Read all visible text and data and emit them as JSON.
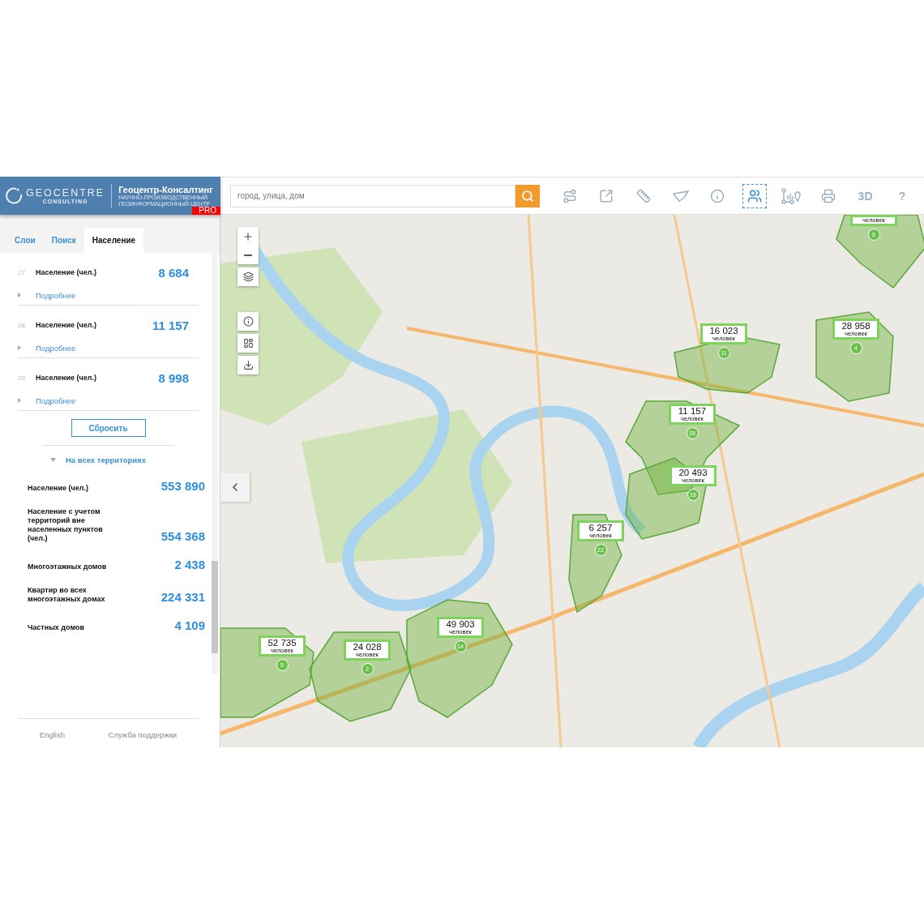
{
  "header": {
    "logo_word": "GEOCENTRE",
    "logo_sub": "CONSULTING",
    "title": "Геоцентр-Консалтинг",
    "subtitle_lines": [
      "НАУЧНО-ПРОИЗВОДСТВЕННЫЙ",
      "ГЕОИНФОРМАЦИОННЫЙ ЦЕНТР"
    ],
    "badge": "PRO"
  },
  "search": {
    "placeholder": "город, улица, дом"
  },
  "toolbar": [
    {
      "kind": "route",
      "selected": false
    },
    {
      "kind": "external",
      "selected": false
    },
    {
      "kind": "ruler",
      "selected": false
    },
    {
      "kind": "polygon",
      "selected": false
    },
    {
      "kind": "info",
      "selected": false
    },
    {
      "kind": "population",
      "selected": true
    },
    {
      "kind": "analytics",
      "selected": false
    },
    {
      "kind": "print",
      "selected": false
    },
    {
      "kind": "text",
      "label": "3D",
      "selected": false
    },
    {
      "kind": "text",
      "label": "?",
      "selected": false
    }
  ],
  "tabs": [
    {
      "label": "Слои",
      "selected": false
    },
    {
      "label": "Поиск",
      "selected": false
    },
    {
      "label": "Население",
      "selected": true
    }
  ],
  "results": [
    {
      "index": "27",
      "label": "Население (чел.)",
      "value": "8 684",
      "link": "Подробнее"
    },
    {
      "index": "28",
      "label": "Население (чел.)",
      "value": "11 157",
      "link": "Подробнее"
    },
    {
      "index": "29",
      "label": "Население (чел.)",
      "value": "8 998",
      "link": "Подробнее"
    }
  ],
  "reset_button": "Сбросить",
  "totals": {
    "title": "На всех территориях",
    "expanded": true,
    "rows": [
      {
        "label": "Население (чел.)",
        "value": "553 890"
      },
      {
        "label": "Население с учетом территорий вне населенных пунктов (чел.)",
        "value": "554 368"
      },
      {
        "label": "Многоэтажных домов",
        "value": "2 438"
      },
      {
        "label": "Квартир во всех многоэтажных домах",
        "value": "224 331"
      },
      {
        "label": "Частных домов",
        "value": "4 109"
      }
    ]
  },
  "footer": [
    "English",
    "Служба поддержки"
  ],
  "map": {
    "callouts": [
      {
        "subtitle": "человек",
        "pin": "8"
      },
      {
        "value": "16 023",
        "subtitle": "человек",
        "pin": "11"
      },
      {
        "value": "28 958",
        "subtitle": "человек",
        "pin": "4"
      },
      {
        "value": "11 157",
        "subtitle": "человек",
        "pin": "28"
      },
      {
        "value": "20 493",
        "subtitle": "человек",
        "pin": "15"
      },
      {
        "value": "6 257",
        "subtitle": "человек",
        "pin": "22"
      },
      {
        "value": "49 903",
        "subtitle": "человек",
        "pin": "14"
      },
      {
        "value": "52 735",
        "subtitle": "человек",
        "pin": "5"
      },
      {
        "value": "24 028",
        "subtitle": "человек",
        "pin": "2"
      }
    ]
  }
}
